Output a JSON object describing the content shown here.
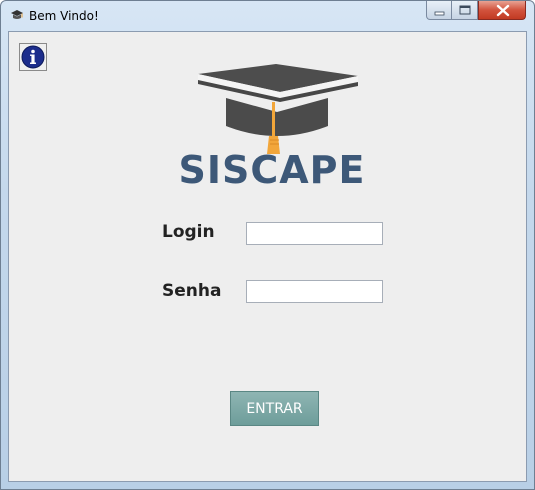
{
  "window": {
    "title": "Bem Vindo!",
    "app_icon": "graduation-cap-icon",
    "controls": [
      "minimize-icon",
      "maximize-icon",
      "close-icon"
    ]
  },
  "header": {
    "info_icon": "info-icon",
    "logo_icon": "graduation-cap-icon",
    "brand": "SISCAPE"
  },
  "form": {
    "login_label": "Login",
    "login_value": "",
    "senha_label": "Senha",
    "senha_value": "",
    "submit_label": "ENTRAR"
  },
  "colors": {
    "brand_text": "#3d5878",
    "cap": "#4a4a4a",
    "tassel": "#f2a63a",
    "button": "#6e9d9a"
  }
}
